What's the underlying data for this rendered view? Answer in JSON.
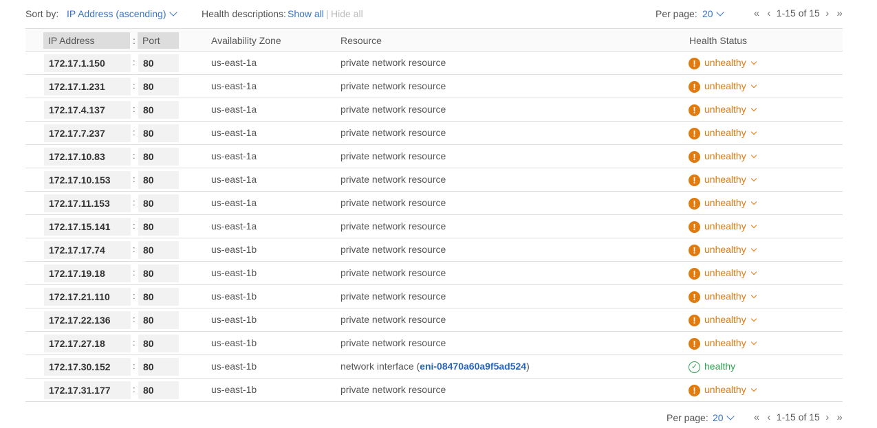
{
  "toolbar": {
    "sort_label": "Sort by:",
    "sort_value": "IP Address (ascending)",
    "health_label": "Health descriptions:",
    "show_all": "Show all",
    "separator": "|",
    "hide_all": "Hide all",
    "per_page_label": "Per page:",
    "per_page_value": "20",
    "range": "1-15 of 15"
  },
  "table": {
    "headers": {
      "ip": "IP Address",
      "colon": ":",
      "port": "Port",
      "az": "Availability Zone",
      "resource": "Resource",
      "health": "Health Status"
    },
    "rows": [
      {
        "ip": "172.17.1.150",
        "port": "80",
        "az": "us-east-1a",
        "resource": "private network resource",
        "status": "unhealthy"
      },
      {
        "ip": "172.17.1.231",
        "port": "80",
        "az": "us-east-1a",
        "resource": "private network resource",
        "status": "unhealthy"
      },
      {
        "ip": "172.17.4.137",
        "port": "80",
        "az": "us-east-1a",
        "resource": "private network resource",
        "status": "unhealthy"
      },
      {
        "ip": "172.17.7.237",
        "port": "80",
        "az": "us-east-1a",
        "resource": "private network resource",
        "status": "unhealthy"
      },
      {
        "ip": "172.17.10.83",
        "port": "80",
        "az": "us-east-1a",
        "resource": "private network resource",
        "status": "unhealthy"
      },
      {
        "ip": "172.17.10.153",
        "port": "80",
        "az": "us-east-1a",
        "resource": "private network resource",
        "status": "unhealthy"
      },
      {
        "ip": "172.17.11.153",
        "port": "80",
        "az": "us-east-1a",
        "resource": "private network resource",
        "status": "unhealthy"
      },
      {
        "ip": "172.17.15.141",
        "port": "80",
        "az": "us-east-1a",
        "resource": "private network resource",
        "status": "unhealthy"
      },
      {
        "ip": "172.17.17.74",
        "port": "80",
        "az": "us-east-1b",
        "resource": "private network resource",
        "status": "unhealthy"
      },
      {
        "ip": "172.17.19.18",
        "port": "80",
        "az": "us-east-1b",
        "resource": "private network resource",
        "status": "unhealthy"
      },
      {
        "ip": "172.17.21.110",
        "port": "80",
        "az": "us-east-1b",
        "resource": "private network resource",
        "status": "unhealthy"
      },
      {
        "ip": "172.17.22.136",
        "port": "80",
        "az": "us-east-1b",
        "resource": "private network resource",
        "status": "unhealthy"
      },
      {
        "ip": "172.17.27.18",
        "port": "80",
        "az": "us-east-1b",
        "resource": "private network resource",
        "status": "unhealthy"
      },
      {
        "ip": "172.17.30.152",
        "port": "80",
        "az": "us-east-1b",
        "resource": "network interface (",
        "resource_link": "eni-08470a60a9f5ad524",
        "resource_suffix": ")",
        "status": "healthy"
      },
      {
        "ip": "172.17.31.177",
        "port": "80",
        "az": "us-east-1b",
        "resource": "private network resource",
        "status": "unhealthy"
      }
    ]
  },
  "footer": {
    "per_page_label": "Per page:",
    "per_page_value": "20",
    "range": "1-15 of 15"
  },
  "icons": {
    "first": "«",
    "prev": "‹",
    "next": "›",
    "last": "»",
    "warn": "!",
    "ok": "✓"
  },
  "colors": {
    "unhealthy": "#e07b10",
    "healthy": "#2ea44f",
    "link": "#3a73c4"
  }
}
